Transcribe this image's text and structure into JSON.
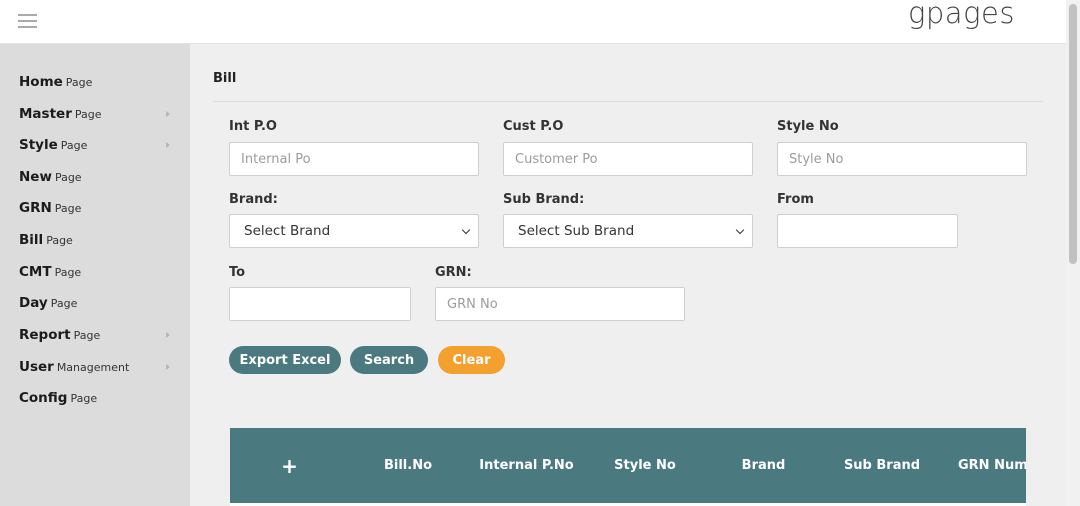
{
  "header": {
    "brand": "gpages",
    "menu_icon": "hamburger-icon"
  },
  "sidebar": {
    "items": [
      {
        "main": "Home",
        "sub": "Page",
        "has_submenu": false
      },
      {
        "main": "Master",
        "sub": "Page",
        "has_submenu": true
      },
      {
        "main": "Style",
        "sub": "Page",
        "has_submenu": true
      },
      {
        "main": "New",
        "sub": "Page",
        "has_submenu": false
      },
      {
        "main": "GRN",
        "sub": "Page",
        "has_submenu": false
      },
      {
        "main": "Bill",
        "sub": "Page",
        "has_submenu": false
      },
      {
        "main": "CMT",
        "sub": "Page",
        "has_submenu": false
      },
      {
        "main": "Day",
        "sub": "Page",
        "has_submenu": false
      },
      {
        "main": "Report",
        "sub": "Page",
        "has_submenu": true
      },
      {
        "main": "User",
        "sub": "Management",
        "has_submenu": true
      },
      {
        "main": "Config",
        "sub": "Page",
        "has_submenu": false
      }
    ]
  },
  "page": {
    "title": "Bill"
  },
  "form": {
    "int_po": {
      "label": "Int P.O",
      "placeholder": "Internal Po",
      "value": ""
    },
    "cust_po": {
      "label": "Cust P.O",
      "placeholder": "Customer Po",
      "value": ""
    },
    "style_no": {
      "label": "Style No",
      "placeholder": "Style No",
      "value": ""
    },
    "brand": {
      "label": "Brand:",
      "selected": "Select Brand"
    },
    "sub_brand": {
      "label": "Sub Brand:",
      "selected": "Select Sub Brand"
    },
    "from": {
      "label": "From",
      "value": ""
    },
    "to": {
      "label": "To",
      "value": ""
    },
    "grn": {
      "label": "GRN:",
      "placeholder": "GRN No",
      "value": ""
    }
  },
  "actions": {
    "export_excel": "Export Excel",
    "search": "Search",
    "clear": "Clear"
  },
  "table": {
    "expand_symbol": "+",
    "columns": [
      "Bill.No",
      "Internal P.No",
      "Style No",
      "Brand",
      "Sub Brand",
      "GRN Numb"
    ]
  },
  "colors": {
    "accent": "#4a7a80",
    "clear": "#f3a02f",
    "sidebar": "#dcdcdc",
    "content": "#efefef"
  }
}
